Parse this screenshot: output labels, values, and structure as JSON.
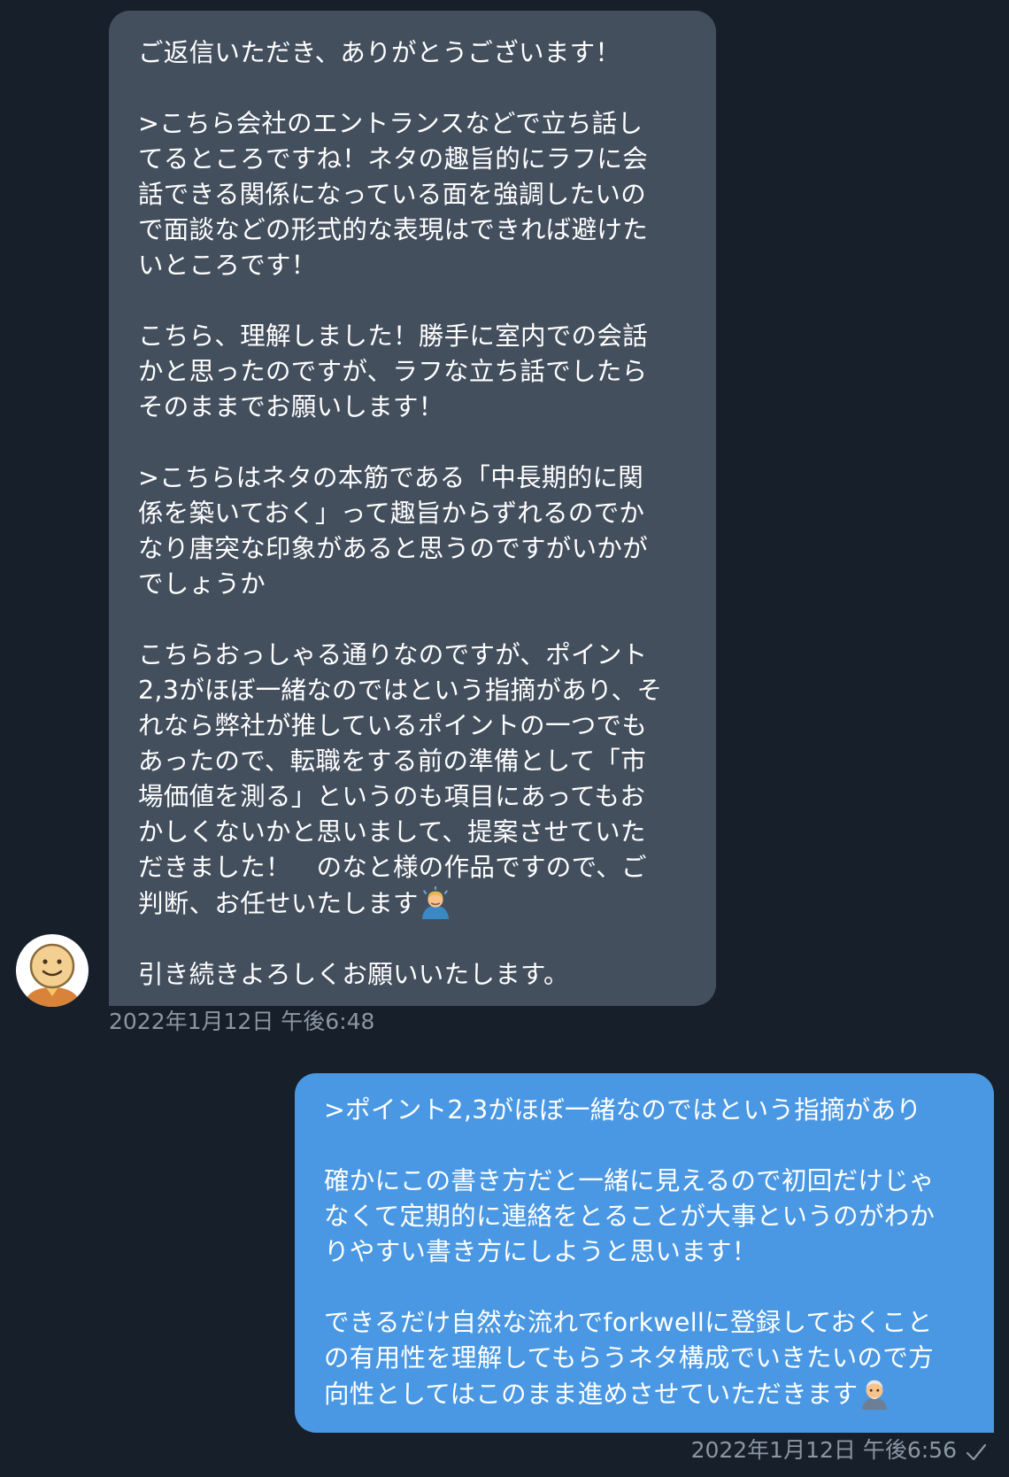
{
  "chat": {
    "incoming": {
      "paragraphs": [
        "ご返信いただき、ありがとうございます！",
        ">こちら会社のエントランスなどで立ち話し\nてるところですね！ネタの趣旨的にラフに会\n話できる関係になっている面を強調したいの\nで面談などの形式的な表現はできれば避けた\nいところです！",
        "こちら、理解しました！勝手に室内での会話\nかと思ったのですが、ラフな立ち話でしたら\nそのままでお願いします！",
        ">こちらはネタの本筋である「中長期的に関\n係を築いておく」って趣旨からずれるのでか\nなり唐突な印象があると思うのですがいかが\nでしょうか",
        "こちらおっしゃる通りなのですが、ポイント\n2,3がほぼ一緒なのではという指摘があり、そ\nれなら弊社が推しているポイントの一つでも\nあったので、転職をする前の準備として「市\n場価値を測る」というのも項目にあってもお\nかしくないかと思いまして、提案させていた\nだきました！　のなと様の作品ですので、ご\n判断、お任せいたします",
        "引き続きよろしくお願いいたします。"
      ],
      "emoji": "man-bowing-emoji",
      "timestamp": "2022年1月12日 午後6:48",
      "avatar": "smiley-face-avatar"
    },
    "outgoing": {
      "paragraphs": [
        ">ポイント2,3がほぼ一緒なのではという指摘があり",
        "確かにこの書き方だと一緒に見えるので初回だけじゃ\nなくて定期的に連絡をとることが大事というのがわか\nりやすい書き方にしようと思います！",
        "できるだけ自然な流れでforkwellに登録しておくこと\nの有用性を理解してもらうネタ構成でいきたいので方\n向性としてはこのまま進めさせていただきます"
      ],
      "emoji": "old-man-emoji",
      "timestamp": "2022年1月12日 午後6:56",
      "read_status": "check-icon"
    }
  },
  "colors": {
    "background": "#17202a",
    "incoming_bubble": "#444f5e",
    "outgoing_bubble": "#4a98e3",
    "timestamp": "#8b96a3",
    "text": "#ffffff"
  }
}
